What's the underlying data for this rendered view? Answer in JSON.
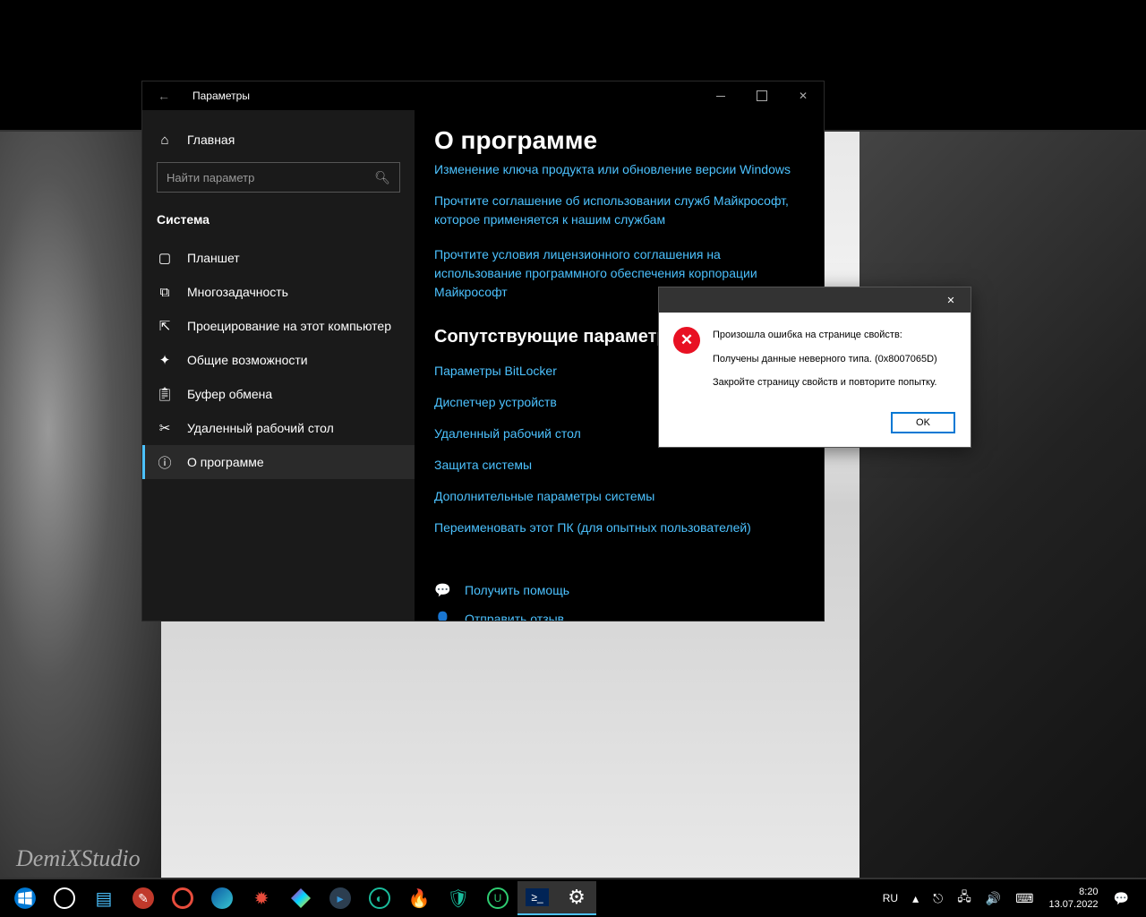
{
  "window": {
    "title": "Параметры"
  },
  "sidebar": {
    "home": "Главная",
    "search_placeholder": "Найти параметр",
    "section": "Система",
    "items": [
      "Планшет",
      "Многозадачность",
      "Проецирование на этот компьютер",
      "Общие возможности",
      "Буфер обмена",
      "Удаленный рабочий стол",
      "О программе"
    ]
  },
  "content": {
    "heading": "О программе",
    "links_top": [
      "Изменение ключа продукта или обновление версии Windows",
      "Прочтите соглашение об использовании служб Майкрософт, которое применяется к нашим службам",
      "Прочтите условия лицензионного соглашения на использование программного обеспечения корпорации Майкрософт"
    ],
    "related_heading": "Сопутствующие параметры",
    "related_links": [
      "Параметры BitLocker",
      "Диспетчер устройств",
      "Удаленный рабочий стол",
      "Защита системы",
      "Дополнительные параметры системы",
      "Переименовать этот ПК (для опытных пользователей)"
    ],
    "help": "Получить помощь",
    "feedback": "Отправить отзыв"
  },
  "dialog": {
    "line1": "Произошла ошибка на странице свойств:",
    "line2": "Получены данные неверного типа. (0x8007065D)",
    "line3": "Закройте страницу свойств и повторите попытку.",
    "ok": "OK"
  },
  "tray": {
    "lang": "RU",
    "time": "8:20",
    "date": "13.07.2022"
  },
  "watermark": "DemiXStudio"
}
